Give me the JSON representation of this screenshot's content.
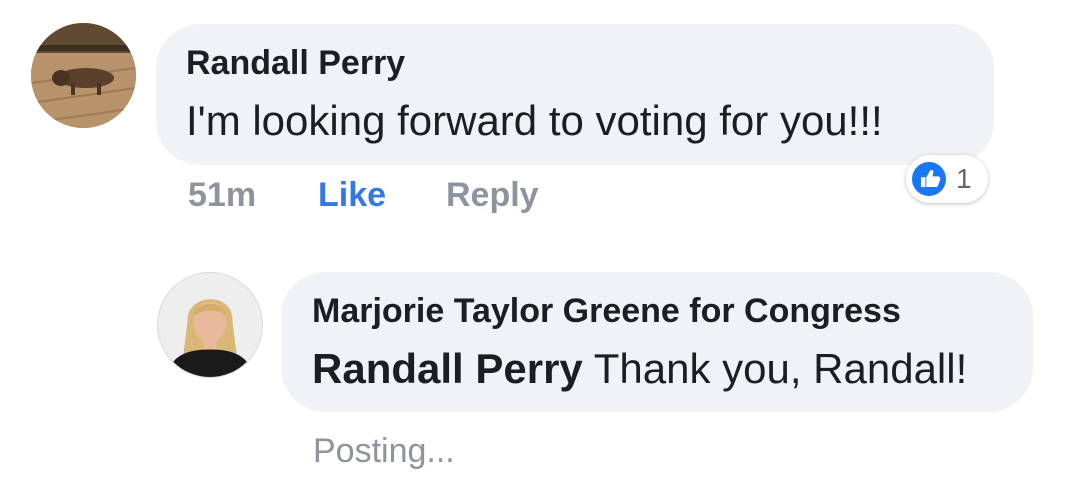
{
  "comment": {
    "author": "Randall Perry",
    "text": "I'm looking forward to voting for you!!!",
    "timestamp": "51m",
    "like_label": "Like",
    "reply_label": "Reply",
    "reaction_count": "1",
    "reaction_icon": "thumbs-up-icon",
    "avatar_icon": "dog-avatar"
  },
  "reply": {
    "author": "Marjorie Taylor Greene for Congress",
    "mention": "Randall Perry",
    "text": " Thank you, Randall!",
    "status": "Posting...",
    "avatar_icon": "woman-avatar"
  },
  "colors": {
    "bubble": "#f0f2f5",
    "like_blue": "#3578e5",
    "muted": "#8d949e",
    "text": "#1c1e21"
  }
}
